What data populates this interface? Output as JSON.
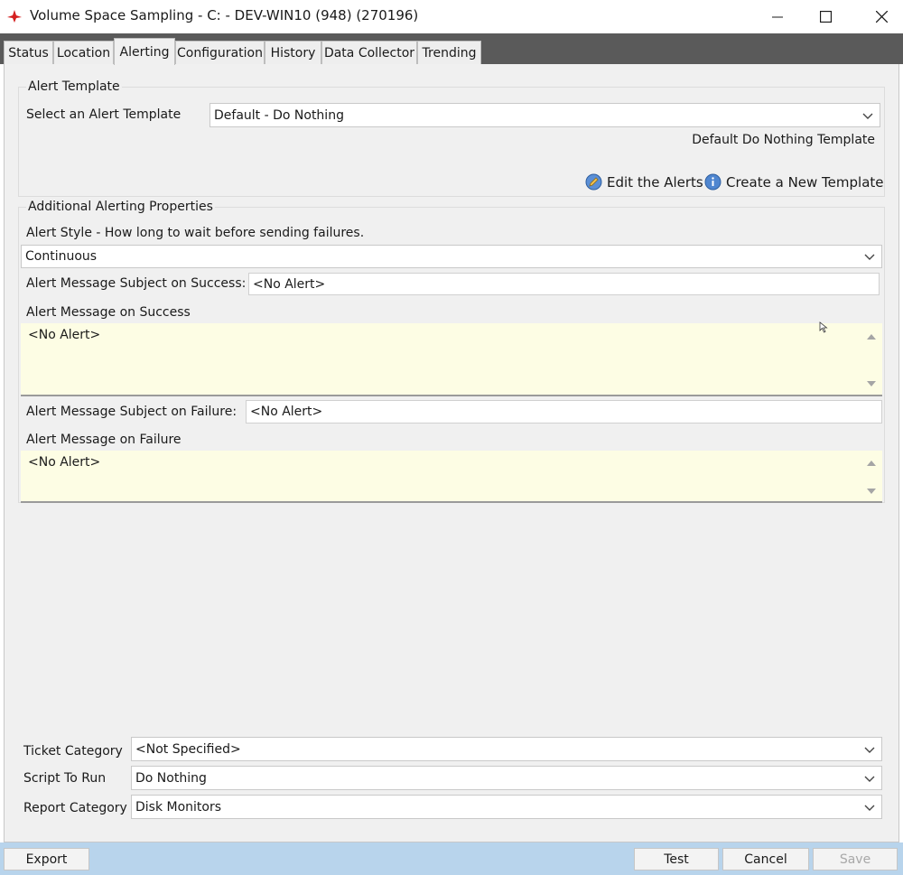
{
  "window": {
    "title": "Volume Space Sampling - C: - DEV-WIN10 (948) (270196)",
    "minimize_glyph": "—",
    "maximize_glyph": "☐",
    "close_glyph": "✕"
  },
  "tabs": [
    {
      "label": "Status"
    },
    {
      "label": "Location"
    },
    {
      "label": "Alerting",
      "active": true
    },
    {
      "label": "Configuration"
    },
    {
      "label": "History"
    },
    {
      "label": "Data Collector"
    },
    {
      "label": "Trending"
    }
  ],
  "alert_template": {
    "group_label": "Alert Template",
    "select_label": "Select an Alert Template",
    "selected_value": "Default - Do Nothing",
    "description": "Default Do Nothing Template",
    "edit_label": "Edit the Alerts",
    "create_label": "Create a New Template"
  },
  "additional": {
    "group_label": "Additional Alerting Properties",
    "alert_style_label": "Alert Style - How long to wait before sending failures.",
    "alert_style_value": "Continuous",
    "success_subject_label": "Alert Message Subject on Success:",
    "success_subject_value": "<No Alert>",
    "success_message_label": "Alert Message on Success",
    "success_message_value": "<No Alert>",
    "failure_subject_label": "Alert Message Subject on Failure:",
    "failure_subject_value": "<No Alert>",
    "failure_message_label": "Alert Message on Failure",
    "failure_message_value": "<No Alert>"
  },
  "bottom_fields": {
    "ticket_category_label": "Ticket Category",
    "ticket_category_value": "<Not Specified>",
    "script_label": "Script To Run",
    "script_value": "Do Nothing",
    "report_category_label": "Report Category",
    "report_category_value": "Disk Monitors"
  },
  "buttons": {
    "export": "Export",
    "test": "Test",
    "cancel": "Cancel",
    "save": "Save"
  },
  "icons": {
    "app": "red-arrow-logo-icon",
    "edit": "edit-pencil-icon",
    "create": "info-icon",
    "dropdown": "chevron-down-icon"
  },
  "colors": {
    "memo_bg": "#fdfde4",
    "bottom_bar": "#b8d4ec",
    "tab_strip": "#5a5a5a",
    "app_icon": "#d42020"
  }
}
